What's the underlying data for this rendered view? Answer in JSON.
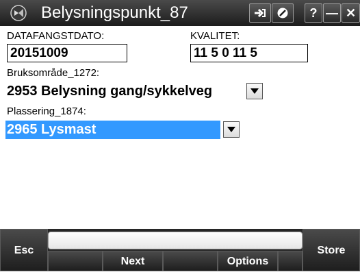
{
  "window": {
    "title": "Belysningspunkt_87",
    "buttons": {
      "help": "?",
      "minimize": "—",
      "close": "✕"
    }
  },
  "form": {
    "datafangstdato": {
      "label": "DATAFANGSTDATO:",
      "value": "20151009"
    },
    "kvalitet": {
      "label": "KVALITET:",
      "value": "11 5 0 11 5"
    },
    "bruksomrade": {
      "label": "Bruksområde_1272:",
      "value": "2953 Belysning gang/sykkelveg"
    },
    "plassering": {
      "label": "Plassering_1874:",
      "value": "2965 Lysmast",
      "highlight_color": "#3399ff"
    }
  },
  "bottombar": {
    "message": "",
    "esc": "Esc",
    "next": "Next",
    "options": "Options",
    "store": "Store"
  },
  "colors": {
    "titlebar": "#2c2c2c",
    "selection": "#3399ff",
    "softkey": "#2a2a2a"
  },
  "icons": [
    "app-logo-icon",
    "link-icon",
    "settings-icon",
    "help-icon",
    "minimize-icon",
    "close-icon",
    "dropdown-arrow-icon"
  ]
}
